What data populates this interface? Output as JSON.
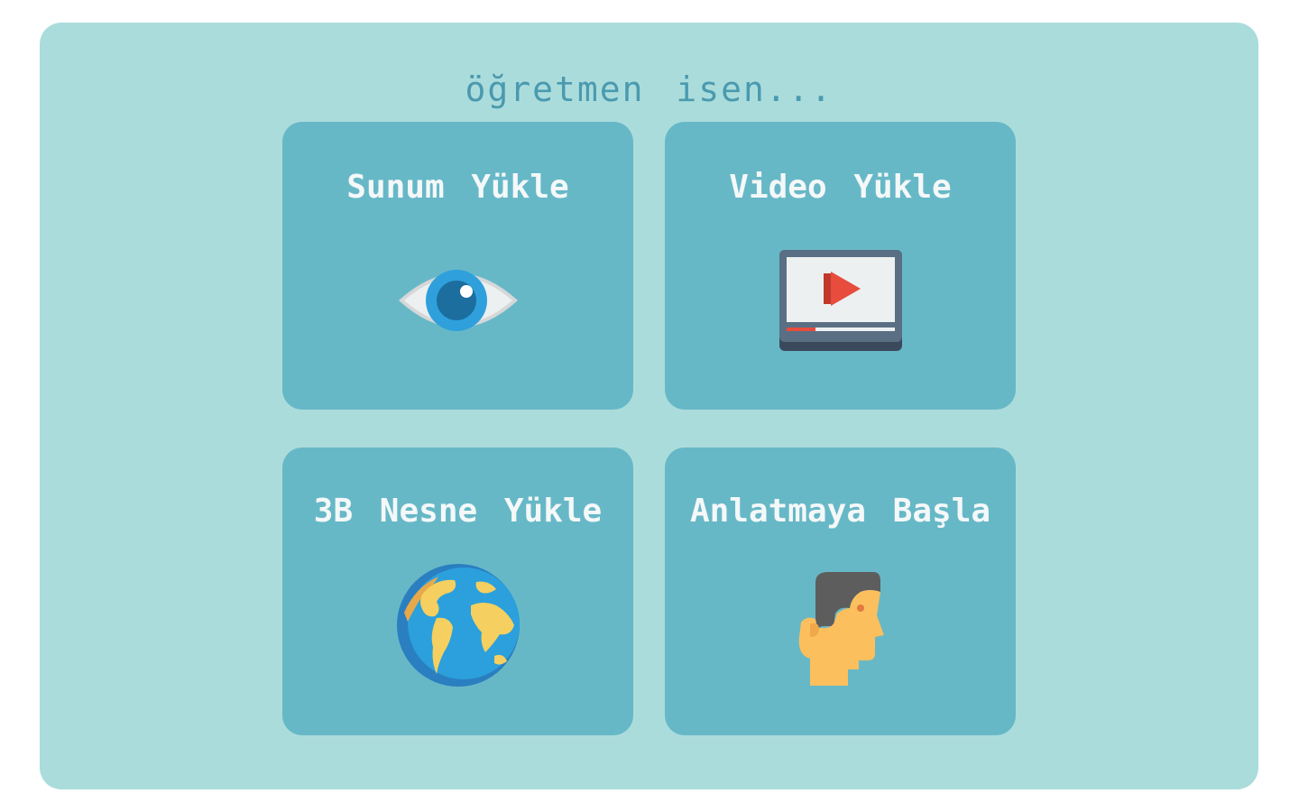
{
  "header": {
    "title": "öğretmen isen..."
  },
  "cards": [
    {
      "label": "Sunum Yükle",
      "icon": "eye-icon"
    },
    {
      "label": "Video Yükle",
      "icon": "video-player-icon"
    },
    {
      "label": "3B Nesne Yükle",
      "icon": "globe-icon"
    },
    {
      "label": "Anlatmaya Başla",
      "icon": "speaker-head-icon"
    }
  ],
  "colors": {
    "page_background": "#ffffff",
    "panel_background": "#abdcdc",
    "card_background": "#67b8c7",
    "title_color": "#3a8fa8",
    "card_text": "#f4f8f8"
  }
}
